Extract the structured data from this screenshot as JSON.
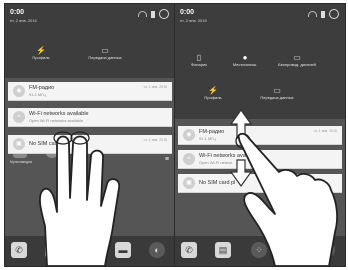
{
  "left_phone": {
    "time": "0:00",
    "date": "пт, 2 янв. 2015",
    "tiles": [
      {
        "icon": "bluetooth-icon",
        "glyph": "⚡",
        "label": "Профиль"
      },
      {
        "icon": "screen-share-icon",
        "glyph": "▭",
        "label": "Передача данных"
      }
    ],
    "notifications": [
      {
        "icon": "radio-icon",
        "glyph": "◉",
        "title": "FM-радио",
        "subtitle": "91.1 МГц",
        "time": "чт, 1 янв. 2015"
      },
      {
        "icon": "wifi-icon",
        "glyph": "≈",
        "title": "Wi-Fi networks available",
        "subtitle": "Open Wi-Fi networks available",
        "time": ""
      },
      {
        "icon": "sim-icon",
        "glyph": "▣",
        "title": "No SIM card",
        "subtitle": "",
        "time": "чт, 1 янв. 2015"
      }
    ],
    "clear_all_glyph": "≡",
    "app_label": "Мультимедиа"
  },
  "right_phone": {
    "time": "0:00",
    "date": "пт, 2 янв. 2015",
    "tiles_row1": [
      {
        "icon": "vibrate-icon",
        "glyph": "▯",
        "label": "Фонарик"
      },
      {
        "icon": "location-icon",
        "glyph": "●",
        "label": "Местополож."
      },
      {
        "icon": "cast-icon",
        "glyph": "▭",
        "label": "Беспровод. дисплей"
      }
    ],
    "tiles_row2": [
      {
        "icon": "bluetooth-icon",
        "glyph": "⚡",
        "label": "Профиль"
      },
      {
        "icon": "screen-share-icon",
        "glyph": "▭",
        "label": "Передача данных"
      }
    ],
    "notifications": [
      {
        "icon": "radio-icon",
        "glyph": "◉",
        "title": "FM-радио",
        "subtitle": "91.1 МГц",
        "time": "чт, 1 янв. 2015"
      },
      {
        "icon": "wifi-icon",
        "glyph": "≈",
        "title": "Wi-Fi networks ava",
        "subtitle": "Open Wi-Fi networ",
        "time": ""
      },
      {
        "icon": "sim-icon",
        "glyph": "▣",
        "title": "No SIM card pl",
        "subtitle": "",
        "time": ""
      }
    ]
  },
  "dock": [
    {
      "icon": "phone-icon",
      "glyph": "✆"
    },
    {
      "icon": "contacts-icon",
      "glyph": "▤"
    },
    {
      "icon": "apps-icon",
      "glyph": "⁘"
    },
    {
      "icon": "messages-icon",
      "glyph": "▬"
    },
    {
      "icon": "browser-icon",
      "glyph": "◐"
    }
  ],
  "colors": {
    "shade": "#3d3d3d",
    "card": "#f4f4f4",
    "home": "#555555"
  }
}
